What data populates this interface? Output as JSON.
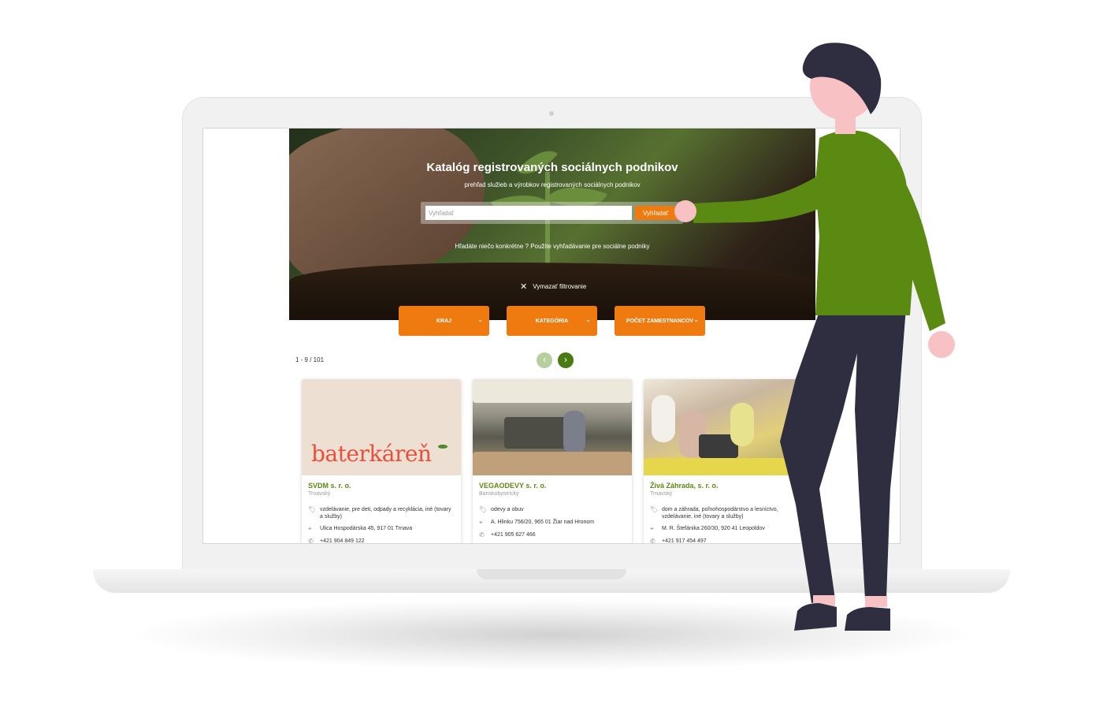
{
  "hero": {
    "title": "Katalóg registrovaných sociálnych podnikov",
    "subtitle": "prehľad služieb a výrobkov registrovaných sociálnych podnikov",
    "search_placeholder": "Vyhľadať",
    "search_button": "Vyhľadať",
    "hint": "Hľadáte niečo konkrétne ? Použite vyhľadávanie pre sociálne podniky",
    "clear_filter": "Vymazať filtrovanie"
  },
  "filters": [
    {
      "label": "KRAJ"
    },
    {
      "label": "KATEGÓRIA"
    },
    {
      "label": "POČET ZAMESTNANCOV"
    }
  ],
  "results": {
    "count": "1 - 9 / 101"
  },
  "cards": [
    {
      "logo_text": "baterkáreň",
      "name": "SVDM s. r. o.",
      "region": "Trnavský",
      "category": "vzdelávanie, pre deti, odpady a recyklácia, iné (tovary a služby)",
      "address": "Ulica Hospodárska 45, 917 01 Trnava",
      "phone": "+421 904 849 122"
    },
    {
      "name": "VEGAODEVY s. r. o.",
      "region": "Banskobystrický",
      "category": "odevy a obuv",
      "address": "A. Hlinku 756/20, 965 01 Žiar nad Hronom",
      "phone": "+421 905 627 466"
    },
    {
      "name": "Živá Záhrada, s. r. o.",
      "region": "Trnavský",
      "category": "dom a záhrada, poľnohospodárstvo a lesníctvo, vzdelávanie, iné (tovary a služby)",
      "address": "M. R. Štefánika 260/30, 920 41 Leopoldov",
      "phone": "+421 917 454 497"
    }
  ],
  "colors": {
    "accent": "#ee7a10",
    "green": "#5c8a12",
    "shirt": "#5a8a12",
    "pants": "#2f2e41",
    "skin": "#f8c1c4"
  },
  "icons": [
    "tag-icon",
    "location-pin-icon",
    "phone-icon",
    "chevron-down-icon",
    "chevron-left-icon",
    "chevron-right-icon",
    "close-icon"
  ]
}
